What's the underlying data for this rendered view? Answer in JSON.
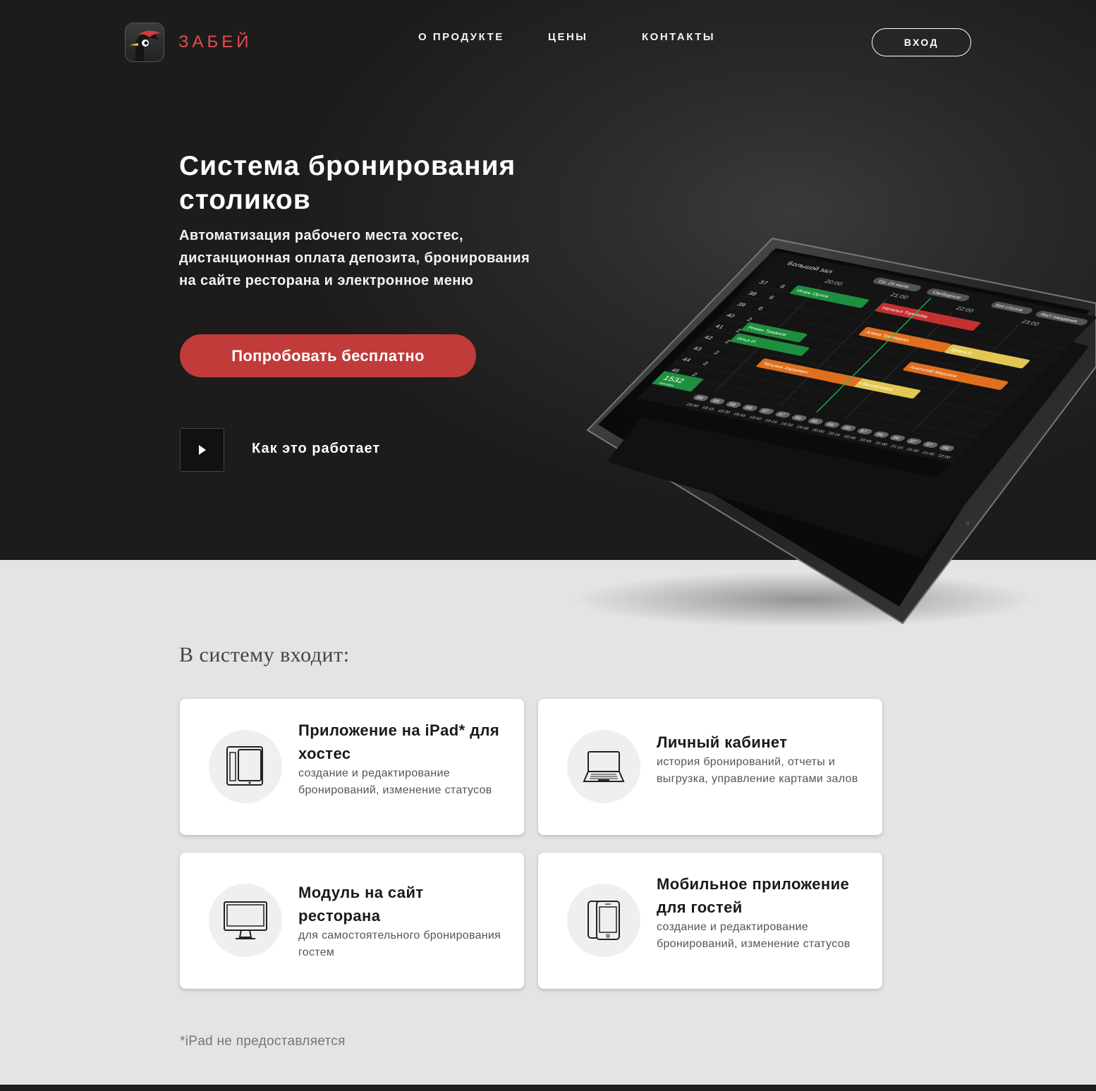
{
  "brand": {
    "name": "ЗАБЕЙ"
  },
  "nav": {
    "about": "О ПРОДУКТЕ",
    "prices": "ЦЕНЫ",
    "contacts": "КОНТАКТЫ",
    "login": "ВХОД"
  },
  "hero": {
    "title": "Система бронирования столиков",
    "subtitle": "Автоматизация рабочего места хостес, дистанционная оплата депозита, бронирования на сайте ресторана и электронное меню",
    "cta": "Попробовать бесплатно",
    "how": "Как это работает"
  },
  "tablet": {
    "hall": "Большой зал",
    "date": "Ср. 25 июля",
    "filter": "Свободные",
    "no_tables": "Без столов",
    "waitlist": "Лист ожидания",
    "guests": "1532",
    "guests_label": "человек",
    "times": [
      "20:00",
      "21:00",
      "22:00",
      "23:00"
    ],
    "table_rows": [
      {
        "num": "37",
        "seats": "6"
      },
      {
        "num": "38",
        "seats": "6"
      },
      {
        "num": "39",
        "seats": "6"
      },
      {
        "num": "40",
        "seats": "2"
      },
      {
        "num": "41",
        "seats": "2"
      },
      {
        "num": "42",
        "seats": "2"
      },
      {
        "num": "43",
        "seats": "2"
      },
      {
        "num": "44",
        "seats": "2"
      },
      {
        "num": "45",
        "seats": "2"
      }
    ],
    "bookings": [
      {
        "name": "Игорь Орлов",
        "color": "#1e8f3e"
      },
      {
        "name": "Наталья Торопова",
        "color": "#c43131"
      },
      {
        "name": "Роман Туманов",
        "color": "#1e8f3e"
      },
      {
        "name": "Илья И.",
        "color": "#1e8f3e"
      },
      {
        "name": "Алина Тропицкая",
        "color": "#e0701e"
      },
      {
        "name": "Диана В.",
        "color": "#e3c653"
      },
      {
        "name": "Анатолий Миронов",
        "color": "#e0701e"
      },
      {
        "name": "Анастасия Михайловна",
        "color": "#e3c653"
      },
      {
        "name": "Татьяна Харцевич",
        "color": "#e0701e"
      }
    ],
    "timeline": [
      "18:00",
      "18:15",
      "18:30",
      "18:45",
      "19:00",
      "19:15",
      "19:30",
      "19:45",
      "20:00",
      "20:15",
      "20:30",
      "20:45",
      "21:00",
      "21:15",
      "21:30",
      "21:45",
      "22:00"
    ],
    "load": [
      "98",
      "99",
      "98",
      "98",
      "97",
      "97",
      "96",
      "96",
      "96",
      "96",
      "97",
      "96",
      "96",
      "97",
      "97",
      "98"
    ]
  },
  "section": {
    "title": "В систему входит:",
    "cards": [
      {
        "title": "Приложение на iPad* для хостес",
        "desc": "создание и редактирование бронирований, изменение статусов",
        "icon": "tablet-icon"
      },
      {
        "title": "Личный кабинет",
        "desc": "история бронирований, отчеты и выгрузка, управление картами залов",
        "icon": "laptop-icon"
      },
      {
        "title": "Модуль на сайт ресторана",
        "desc": "для самостоятельного бронирования гостем",
        "icon": "monitor-icon"
      },
      {
        "title": "Мобильное приложение для гостей",
        "desc": "создание и редактирование бронирований, изменение статусов",
        "icon": "smartphone-icon"
      }
    ],
    "footnote": "*iPad не предоставляется"
  },
  "colors": {
    "accent": "#c13b3b",
    "brand": "#e44c4c",
    "dark": "#1c1c1c",
    "bg": "#e4e4e4"
  }
}
